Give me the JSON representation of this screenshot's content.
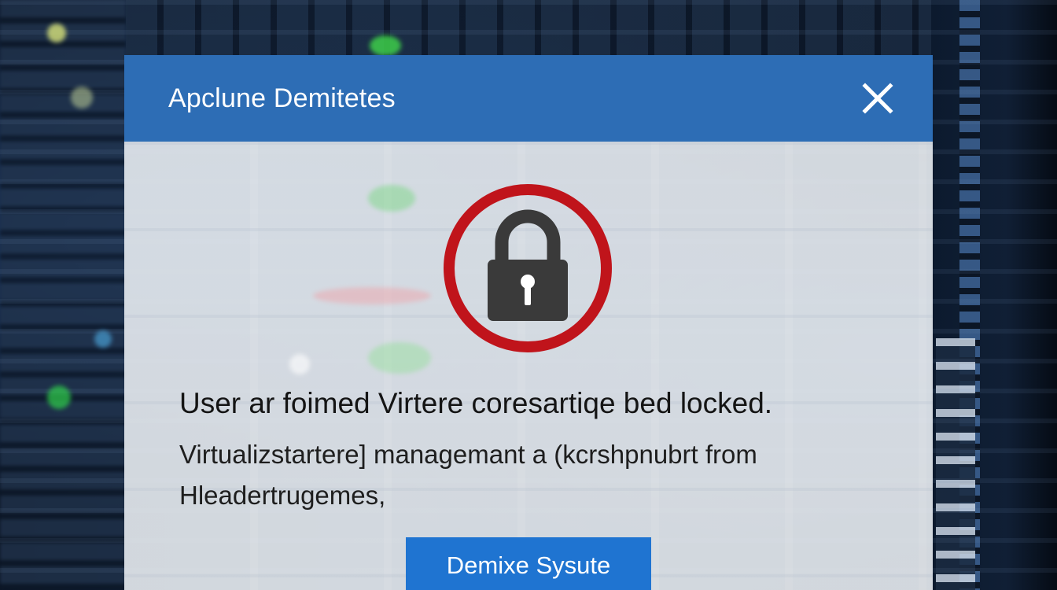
{
  "dialog": {
    "title": "Apclune Demitetes",
    "close_icon": "close-icon",
    "lock_icon": "lock-icon",
    "heading": "User ar foimed Virtere coresartiqe bed locked.",
    "body_line_1": "Virtualizstartere] managemant a (kcrshpnubrt from",
    "body_line_2": "Hleadertrugemes,",
    "button_label": "Demixe Sysute"
  },
  "colors": {
    "header": "#2d6db5",
    "button": "#1f74d1",
    "lock_ring": "#c0141b",
    "lock_body": "#3a3a3a"
  }
}
